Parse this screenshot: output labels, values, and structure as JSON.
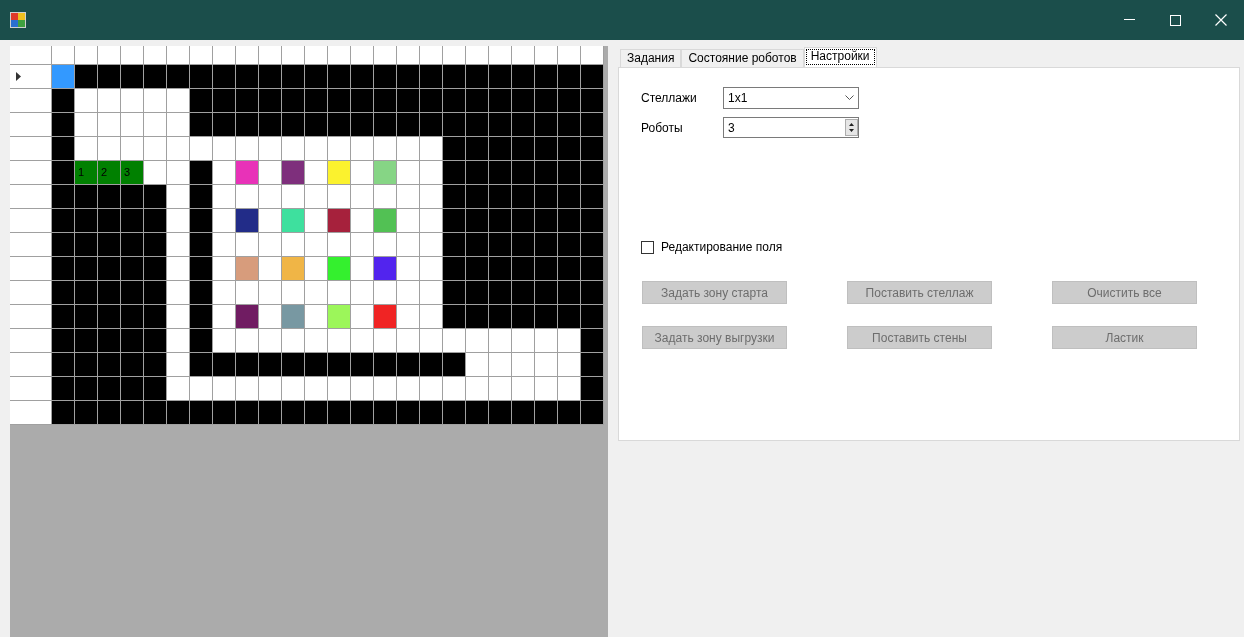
{
  "grid": {
    "rows": [
      {
        "current": true,
        "cells": [
          {
            "kind": "selected"
          },
          {
            "kind": "wall"
          },
          {
            "kind": "wall"
          },
          {
            "kind": "wall"
          },
          {
            "kind": "wall"
          },
          {
            "kind": "wall"
          },
          {
            "kind": "wall"
          },
          {
            "kind": "wall"
          },
          {
            "kind": "wall"
          },
          {
            "kind": "wall"
          },
          {
            "kind": "wall"
          },
          {
            "kind": "wall"
          },
          {
            "kind": "wall"
          },
          {
            "kind": "wall"
          },
          {
            "kind": "wall"
          },
          {
            "kind": "wall"
          },
          {
            "kind": "wall"
          },
          {
            "kind": "wall"
          },
          {
            "kind": "wall"
          },
          {
            "kind": "wall"
          },
          {
            "kind": "wall"
          },
          {
            "kind": "wall"
          },
          {
            "kind": "wall"
          },
          {
            "kind": "wall"
          }
        ]
      },
      {
        "current": false,
        "cells": [
          {
            "kind": "wall"
          },
          {
            "kind": "free"
          },
          {
            "kind": "free"
          },
          {
            "kind": "free"
          },
          {
            "kind": "free"
          },
          {
            "kind": "free"
          },
          {
            "kind": "wall"
          },
          {
            "kind": "wall"
          },
          {
            "kind": "wall"
          },
          {
            "kind": "wall"
          },
          {
            "kind": "wall"
          },
          {
            "kind": "wall"
          },
          {
            "kind": "wall"
          },
          {
            "kind": "wall"
          },
          {
            "kind": "wall"
          },
          {
            "kind": "wall"
          },
          {
            "kind": "wall"
          },
          {
            "kind": "wall"
          },
          {
            "kind": "wall"
          },
          {
            "kind": "wall"
          },
          {
            "kind": "wall"
          },
          {
            "kind": "wall"
          },
          {
            "kind": "wall"
          },
          {
            "kind": "wall"
          }
        ]
      },
      {
        "current": false,
        "cells": [
          {
            "kind": "wall"
          },
          {
            "kind": "free"
          },
          {
            "kind": "free"
          },
          {
            "kind": "free"
          },
          {
            "kind": "free"
          },
          {
            "kind": "free"
          },
          {
            "kind": "wall"
          },
          {
            "kind": "wall"
          },
          {
            "kind": "wall"
          },
          {
            "kind": "wall"
          },
          {
            "kind": "wall"
          },
          {
            "kind": "wall"
          },
          {
            "kind": "wall"
          },
          {
            "kind": "wall"
          },
          {
            "kind": "wall"
          },
          {
            "kind": "wall"
          },
          {
            "kind": "wall"
          },
          {
            "kind": "wall"
          },
          {
            "kind": "wall"
          },
          {
            "kind": "wall"
          },
          {
            "kind": "wall"
          },
          {
            "kind": "wall"
          },
          {
            "kind": "wall"
          },
          {
            "kind": "wall"
          }
        ]
      },
      {
        "current": false,
        "cells": [
          {
            "kind": "wall"
          },
          {
            "kind": "free"
          },
          {
            "kind": "free"
          },
          {
            "kind": "free"
          },
          {
            "kind": "free"
          },
          {
            "kind": "free"
          },
          {
            "kind": "free"
          },
          {
            "kind": "free"
          },
          {
            "kind": "free"
          },
          {
            "kind": "free"
          },
          {
            "kind": "free"
          },
          {
            "kind": "free"
          },
          {
            "kind": "free"
          },
          {
            "kind": "free"
          },
          {
            "kind": "free"
          },
          {
            "kind": "free"
          },
          {
            "kind": "free"
          },
          {
            "kind": "wall"
          },
          {
            "kind": "wall"
          },
          {
            "kind": "wall"
          },
          {
            "kind": "wall"
          },
          {
            "kind": "wall"
          },
          {
            "kind": "wall"
          },
          {
            "kind": "wall"
          }
        ]
      },
      {
        "current": false,
        "cells": [
          {
            "kind": "wall"
          },
          {
            "kind": "robot",
            "label": "1"
          },
          {
            "kind": "robot",
            "label": "2"
          },
          {
            "kind": "robot",
            "label": "3"
          },
          {
            "kind": "free"
          },
          {
            "kind": "free"
          },
          {
            "kind": "wall"
          },
          {
            "kind": "free"
          },
          {
            "kind": "shelf",
            "color": "#e832b8"
          },
          {
            "kind": "free"
          },
          {
            "kind": "shelf",
            "color": "#7e2f7c"
          },
          {
            "kind": "free"
          },
          {
            "kind": "shelf",
            "color": "#fbf22e"
          },
          {
            "kind": "free"
          },
          {
            "kind": "shelf",
            "color": "#86d585"
          },
          {
            "kind": "free"
          },
          {
            "kind": "free"
          },
          {
            "kind": "wall"
          },
          {
            "kind": "wall"
          },
          {
            "kind": "wall"
          },
          {
            "kind": "wall"
          },
          {
            "kind": "wall"
          },
          {
            "kind": "wall"
          },
          {
            "kind": "wall"
          }
        ]
      },
      {
        "current": false,
        "cells": [
          {
            "kind": "wall"
          },
          {
            "kind": "wall"
          },
          {
            "kind": "wall"
          },
          {
            "kind": "wall"
          },
          {
            "kind": "wall"
          },
          {
            "kind": "free"
          },
          {
            "kind": "wall"
          },
          {
            "kind": "free"
          },
          {
            "kind": "free"
          },
          {
            "kind": "free"
          },
          {
            "kind": "free"
          },
          {
            "kind": "free"
          },
          {
            "kind": "free"
          },
          {
            "kind": "free"
          },
          {
            "kind": "free"
          },
          {
            "kind": "free"
          },
          {
            "kind": "free"
          },
          {
            "kind": "wall"
          },
          {
            "kind": "wall"
          },
          {
            "kind": "wall"
          },
          {
            "kind": "wall"
          },
          {
            "kind": "wall"
          },
          {
            "kind": "wall"
          },
          {
            "kind": "wall"
          }
        ]
      },
      {
        "current": false,
        "cells": [
          {
            "kind": "wall"
          },
          {
            "kind": "wall"
          },
          {
            "kind": "wall"
          },
          {
            "kind": "wall"
          },
          {
            "kind": "wall"
          },
          {
            "kind": "free"
          },
          {
            "kind": "wall"
          },
          {
            "kind": "free"
          },
          {
            "kind": "shelf",
            "color": "#222c88"
          },
          {
            "kind": "free"
          },
          {
            "kind": "shelf",
            "color": "#3ee09e"
          },
          {
            "kind": "free"
          },
          {
            "kind": "shelf",
            "color": "#a6213c"
          },
          {
            "kind": "free"
          },
          {
            "kind": "shelf",
            "color": "#52c154"
          },
          {
            "kind": "free"
          },
          {
            "kind": "free"
          },
          {
            "kind": "wall"
          },
          {
            "kind": "wall"
          },
          {
            "kind": "wall"
          },
          {
            "kind": "wall"
          },
          {
            "kind": "wall"
          },
          {
            "kind": "wall"
          },
          {
            "kind": "wall"
          }
        ]
      },
      {
        "current": false,
        "cells": [
          {
            "kind": "wall"
          },
          {
            "kind": "wall"
          },
          {
            "kind": "wall"
          },
          {
            "kind": "wall"
          },
          {
            "kind": "wall"
          },
          {
            "kind": "free"
          },
          {
            "kind": "wall"
          },
          {
            "kind": "free"
          },
          {
            "kind": "free"
          },
          {
            "kind": "free"
          },
          {
            "kind": "free"
          },
          {
            "kind": "free"
          },
          {
            "kind": "free"
          },
          {
            "kind": "free"
          },
          {
            "kind": "free"
          },
          {
            "kind": "free"
          },
          {
            "kind": "free"
          },
          {
            "kind": "wall"
          },
          {
            "kind": "wall"
          },
          {
            "kind": "wall"
          },
          {
            "kind": "wall"
          },
          {
            "kind": "wall"
          },
          {
            "kind": "wall"
          },
          {
            "kind": "wall"
          }
        ]
      },
      {
        "current": false,
        "cells": [
          {
            "kind": "wall"
          },
          {
            "kind": "wall"
          },
          {
            "kind": "wall"
          },
          {
            "kind": "wall"
          },
          {
            "kind": "wall"
          },
          {
            "kind": "free"
          },
          {
            "kind": "wall"
          },
          {
            "kind": "free"
          },
          {
            "kind": "shelf",
            "color": "#d79c7c"
          },
          {
            "kind": "free"
          },
          {
            "kind": "shelf",
            "color": "#f0b546"
          },
          {
            "kind": "free"
          },
          {
            "kind": "shelf",
            "color": "#34f02e"
          },
          {
            "kind": "free"
          },
          {
            "kind": "shelf",
            "color": "#5224ee"
          },
          {
            "kind": "free"
          },
          {
            "kind": "free"
          },
          {
            "kind": "wall"
          },
          {
            "kind": "wall"
          },
          {
            "kind": "wall"
          },
          {
            "kind": "wall"
          },
          {
            "kind": "wall"
          },
          {
            "kind": "wall"
          },
          {
            "kind": "wall"
          }
        ]
      },
      {
        "current": false,
        "cells": [
          {
            "kind": "wall"
          },
          {
            "kind": "wall"
          },
          {
            "kind": "wall"
          },
          {
            "kind": "wall"
          },
          {
            "kind": "wall"
          },
          {
            "kind": "free"
          },
          {
            "kind": "wall"
          },
          {
            "kind": "free"
          },
          {
            "kind": "free"
          },
          {
            "kind": "free"
          },
          {
            "kind": "free"
          },
          {
            "kind": "free"
          },
          {
            "kind": "free"
          },
          {
            "kind": "free"
          },
          {
            "kind": "free"
          },
          {
            "kind": "free"
          },
          {
            "kind": "free"
          },
          {
            "kind": "wall"
          },
          {
            "kind": "wall"
          },
          {
            "kind": "wall"
          },
          {
            "kind": "wall"
          },
          {
            "kind": "wall"
          },
          {
            "kind": "wall"
          },
          {
            "kind": "wall"
          }
        ]
      },
      {
        "current": false,
        "cells": [
          {
            "kind": "wall"
          },
          {
            "kind": "wall"
          },
          {
            "kind": "wall"
          },
          {
            "kind": "wall"
          },
          {
            "kind": "wall"
          },
          {
            "kind": "free"
          },
          {
            "kind": "wall"
          },
          {
            "kind": "free"
          },
          {
            "kind": "shelf",
            "color": "#701c62"
          },
          {
            "kind": "free"
          },
          {
            "kind": "shelf",
            "color": "#7898a2"
          },
          {
            "kind": "free"
          },
          {
            "kind": "shelf",
            "color": "#9cf65a"
          },
          {
            "kind": "free"
          },
          {
            "kind": "shelf",
            "color": "#f02424"
          },
          {
            "kind": "free"
          },
          {
            "kind": "free"
          },
          {
            "kind": "wall"
          },
          {
            "kind": "wall"
          },
          {
            "kind": "wall"
          },
          {
            "kind": "wall"
          },
          {
            "kind": "wall"
          },
          {
            "kind": "wall"
          },
          {
            "kind": "wall"
          }
        ]
      },
      {
        "current": false,
        "cells": [
          {
            "kind": "wall"
          },
          {
            "kind": "wall"
          },
          {
            "kind": "wall"
          },
          {
            "kind": "wall"
          },
          {
            "kind": "wall"
          },
          {
            "kind": "free"
          },
          {
            "kind": "wall"
          },
          {
            "kind": "free"
          },
          {
            "kind": "free"
          },
          {
            "kind": "free"
          },
          {
            "kind": "free"
          },
          {
            "kind": "free"
          },
          {
            "kind": "free"
          },
          {
            "kind": "free"
          },
          {
            "kind": "free"
          },
          {
            "kind": "free"
          },
          {
            "kind": "free"
          },
          {
            "kind": "free"
          },
          {
            "kind": "free"
          },
          {
            "kind": "free"
          },
          {
            "kind": "free"
          },
          {
            "kind": "free"
          },
          {
            "kind": "free"
          },
          {
            "kind": "wall"
          }
        ]
      },
      {
        "current": false,
        "cells": [
          {
            "kind": "wall"
          },
          {
            "kind": "wall"
          },
          {
            "kind": "wall"
          },
          {
            "kind": "wall"
          },
          {
            "kind": "wall"
          },
          {
            "kind": "free"
          },
          {
            "kind": "wall"
          },
          {
            "kind": "wall"
          },
          {
            "kind": "wall"
          },
          {
            "kind": "wall"
          },
          {
            "kind": "wall"
          },
          {
            "kind": "wall"
          },
          {
            "kind": "wall"
          },
          {
            "kind": "wall"
          },
          {
            "kind": "wall"
          },
          {
            "kind": "wall"
          },
          {
            "kind": "wall"
          },
          {
            "kind": "wall"
          },
          {
            "kind": "free"
          },
          {
            "kind": "free"
          },
          {
            "kind": "free"
          },
          {
            "kind": "free"
          },
          {
            "kind": "free"
          },
          {
            "kind": "wall"
          }
        ]
      },
      {
        "current": false,
        "cells": [
          {
            "kind": "wall"
          },
          {
            "kind": "wall"
          },
          {
            "kind": "wall"
          },
          {
            "kind": "wall"
          },
          {
            "kind": "wall"
          },
          {
            "kind": "free"
          },
          {
            "kind": "free"
          },
          {
            "kind": "free"
          },
          {
            "kind": "free"
          },
          {
            "kind": "free"
          },
          {
            "kind": "free"
          },
          {
            "kind": "free"
          },
          {
            "kind": "free"
          },
          {
            "kind": "free"
          },
          {
            "kind": "free"
          },
          {
            "kind": "free"
          },
          {
            "kind": "free"
          },
          {
            "kind": "free"
          },
          {
            "kind": "free"
          },
          {
            "kind": "free"
          },
          {
            "kind": "free"
          },
          {
            "kind": "free"
          },
          {
            "kind": "free"
          },
          {
            "kind": "wall"
          }
        ]
      },
      {
        "current": false,
        "cells": [
          {
            "kind": "wall"
          },
          {
            "kind": "wall"
          },
          {
            "kind": "wall"
          },
          {
            "kind": "wall"
          },
          {
            "kind": "wall"
          },
          {
            "kind": "wall"
          },
          {
            "kind": "wall"
          },
          {
            "kind": "wall"
          },
          {
            "kind": "wall"
          },
          {
            "kind": "wall"
          },
          {
            "kind": "wall"
          },
          {
            "kind": "wall"
          },
          {
            "kind": "wall"
          },
          {
            "kind": "wall"
          },
          {
            "kind": "wall"
          },
          {
            "kind": "wall"
          },
          {
            "kind": "wall"
          },
          {
            "kind": "wall"
          },
          {
            "kind": "wall"
          },
          {
            "kind": "wall"
          },
          {
            "kind": "wall"
          },
          {
            "kind": "wall"
          },
          {
            "kind": "wall"
          },
          {
            "kind": "wall"
          }
        ]
      }
    ]
  },
  "tabs": [
    {
      "label": "Задания",
      "selected": false
    },
    {
      "label": "Состояние роботов",
      "selected": false
    },
    {
      "label": "Настройки",
      "selected": true
    }
  ],
  "settings": {
    "racks_label": "Стеллажи",
    "racks_value": "1x1",
    "robots_label": "Роботы",
    "robots_value": "3",
    "edit_checkbox": {
      "label": "Редактирование поля",
      "checked": false
    },
    "buttons": [
      {
        "label": "Задать зону старта",
        "disabled": true
      },
      {
        "label": "Поставить стеллаж",
        "disabled": true
      },
      {
        "label": "Очистить все",
        "disabled": true
      },
      {
        "label": "Задать зону выгрузки",
        "disabled": true
      },
      {
        "label": "Поставить стены",
        "disabled": true
      },
      {
        "label": "Ластик",
        "disabled": true
      }
    ]
  }
}
